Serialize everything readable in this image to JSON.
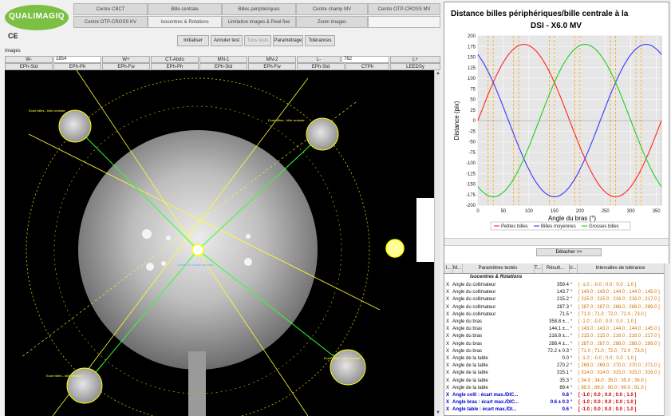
{
  "brand": {
    "logo_text": "QUALIMAGIQ",
    "ce_mark": "CE"
  },
  "nav": {
    "row1": [
      "Centre CBCT",
      "Bille centrale",
      "Billes périphériques",
      "Centre champ MV",
      "Centre OTP-CROSS MV"
    ],
    "row2": [
      "Centre OTP-CROSS KV",
      "Isocentres & Rotations",
      "Limitation images & Pixel fixe",
      "Zoom images"
    ]
  },
  "actions": [
    "Initialiser",
    "Annuler test",
    "Tous tests",
    "Paramétrage",
    "Tolérances"
  ],
  "images_label": "Images",
  "controls": {
    "w_label": "W-",
    "w_value": "1854",
    "w_plus": "W+",
    "ct_abdo": "CT-Abdo",
    "mn1": "MN-1",
    "mn2": "MN-2",
    "l_minus": "L-",
    "l_value": "762",
    "l_plus": "L+"
  },
  "filters": [
    "EPh-Std",
    "EPh-Ph",
    "EPh-Fw",
    "EPh-Ph",
    "EPh-Std",
    "EPh-Fw",
    "EPh-Std",
    "CTPh",
    "LEEDSy"
  ],
  "image_annotations": {
    "top_left": "Ecart billes - bille centrale",
    "top_right": "Ecart billes - bille centrale",
    "center": "Centre de la bille centrale",
    "bottom_left": "Ecart billes - bille centrale",
    "bottom_right": "Ecart billes - bille centrale"
  },
  "chart_data": {
    "type": "line",
    "title": "Distance billes périphériques/bille centrale à la",
    "subtitle": "DSI - X6.0 MV",
    "xlabel": "Angle du bras (°)",
    "ylabel": "Distance (pix)",
    "xlim": [
      0,
      360
    ],
    "ylim": [
      -200,
      200
    ],
    "x_ticks": [
      0,
      50,
      100,
      150,
      200,
      250,
      300,
      350
    ],
    "y_ticks": [
      200,
      175,
      150,
      125,
      100,
      75,
      50,
      25,
      0,
      -25,
      -50,
      -75,
      -100,
      -125,
      -150,
      -175,
      -200
    ],
    "grid": true,
    "legend_position": "bottom",
    "series": [
      {
        "name": "Petites billes",
        "color": "#ff3333",
        "amplitude": 180,
        "phase_deg": 0
      },
      {
        "name": "Billes moyennes",
        "color": "#4444ff",
        "amplitude": 180,
        "phase_deg": 120
      },
      {
        "name": "Grosses billes",
        "color": "#33cc33",
        "amplitude": 180,
        "phase_deg": 240
      }
    ],
    "orange_vlines": [
      20,
      30,
      70,
      80,
      140,
      150,
      190,
      200,
      260,
      270,
      310,
      320
    ]
  },
  "detach_label": "Détacher >>",
  "table": {
    "headers": [
      "I...",
      "M...",
      "Paramètres testés",
      "T...",
      "Résult...",
      "U...",
      "Intervalles de tolérance"
    ],
    "section": "Isocentres & Rotations",
    "rows": [
      {
        "i": "X",
        "param": "Angle du collimateur",
        "res": "359.4",
        "u": "°",
        "tol": "[ -1.0 ; -0.0 ; 0.0 ; 0.0 ; 1.0 ]",
        "blue": false
      },
      {
        "i": "X",
        "param": "Angle du collimateur",
        "res": "143.7",
        "u": "°",
        "tol": "[ 143.0 ; 143.0 ; 144.0 ; 144.0 ; 145.0 ]",
        "blue": false
      },
      {
        "i": "X",
        "param": "Angle du collimateur",
        "res": "215.2",
        "u": "°",
        "tol": "[ 215.0 ; 215.0 ; 216.0 ; 216.0 ; 217.0 ]",
        "blue": false
      },
      {
        "i": "X",
        "param": "Angle du collimateur",
        "res": "287.3",
        "u": "°",
        "tol": "[ 287.0 ; 287.0 ; 288.0 ; 288.0 ; 289.0 ]",
        "blue": false
      },
      {
        "i": "X",
        "param": "Angle du collimateur",
        "res": "71.5",
        "u": "°",
        "tol": "[ 71.0 ; 71.0 ; 72.0 ; 72.0 ; 73.0 ]",
        "blue": false
      },
      {
        "i": "X",
        "param": "Angle du bras",
        "res": "358.8 ±...",
        "u": "°",
        "tol": "[ -1.0 ; -0.0 ; 0.0 ; 0.0 ; 1.0 ]",
        "blue": false
      },
      {
        "i": "X",
        "param": "Angle du bras",
        "res": "144.1 ±...",
        "u": "°",
        "tol": "[ 143.0 ; 143.0 ; 144.0 ; 144.0 ; 145.0 ]",
        "blue": false
      },
      {
        "i": "X",
        "param": "Angle du bras",
        "res": "216.8 ±...",
        "u": "°",
        "tol": "[ 215.0 ; 215.0 ; 216.0 ; 216.0 ; 217.0 ]",
        "blue": false
      },
      {
        "i": "X",
        "param": "Angle du bras",
        "res": "288.4 ±...",
        "u": "°",
        "tol": "[ 287.0 ; 287.0 ; 288.0 ; 288.0 ; 289.0 ]",
        "blue": false
      },
      {
        "i": "X",
        "param": "Angle du bras",
        "res": "72.2 ± 0.3",
        "u": "°",
        "tol": "[ 71.0 ; 71.0 ; 72.0 ; 72.0 ; 73.0 ]",
        "blue": false
      },
      {
        "i": "X",
        "param": "Angle de la table",
        "res": "0.0",
        "u": "°",
        "tol": "[ -1.0 ; -0.0 ; 0.0 ; 0.0 ; 1.0 ]",
        "blue": false
      },
      {
        "i": "X",
        "param": "Angle de la table",
        "res": "270.2",
        "u": "°",
        "tol": "[ 269.0 ; 269.0 ; 270.0 ; 270.0 ; 271.0 ]",
        "blue": false
      },
      {
        "i": "X",
        "param": "Angle de la table",
        "res": "315.1",
        "u": "°",
        "tol": "[ 314.0 ; 314.0 ; 315.0 ; 315.0 ; 316.0 ]",
        "blue": false
      },
      {
        "i": "X",
        "param": "Angle de la table",
        "res": "35.3",
        "u": "°",
        "tol": "[ 34.0 ; 34.0 ; 35.0 ; 35.0 ; 36.0 ]",
        "blue": false
      },
      {
        "i": "X",
        "param": "Angle de la table",
        "res": "89.4",
        "u": "°",
        "tol": "[ 89.0 ; 89.0 ; 90.0 ; 90.0 ; 91.0 ]",
        "blue": false
      },
      {
        "i": "X",
        "param": "Angle colli : écart max./DIC...",
        "res": "0.8",
        "u": "°",
        "tol": "[ -1.0 ; 0.0 ; 0.0 ; 0.0 ; 1.0 ]",
        "blue": true
      },
      {
        "i": "X",
        "param": "Angle bras : écart max./DIC...",
        "res": "0.6 ± 0.3",
        "u": "°",
        "tol": "[ -1.0 ; 0.0 ; 0.0 ; 0.0 ; 1.0 ]",
        "blue": true
      },
      {
        "i": "X",
        "param": "Angle table : écart max./DI...",
        "res": "0.6",
        "u": "°",
        "tol": "[ -1.0 ; 0.0 ; 0.0 ; 0.0 ; 1.0 ]",
        "blue": true
      }
    ]
  }
}
